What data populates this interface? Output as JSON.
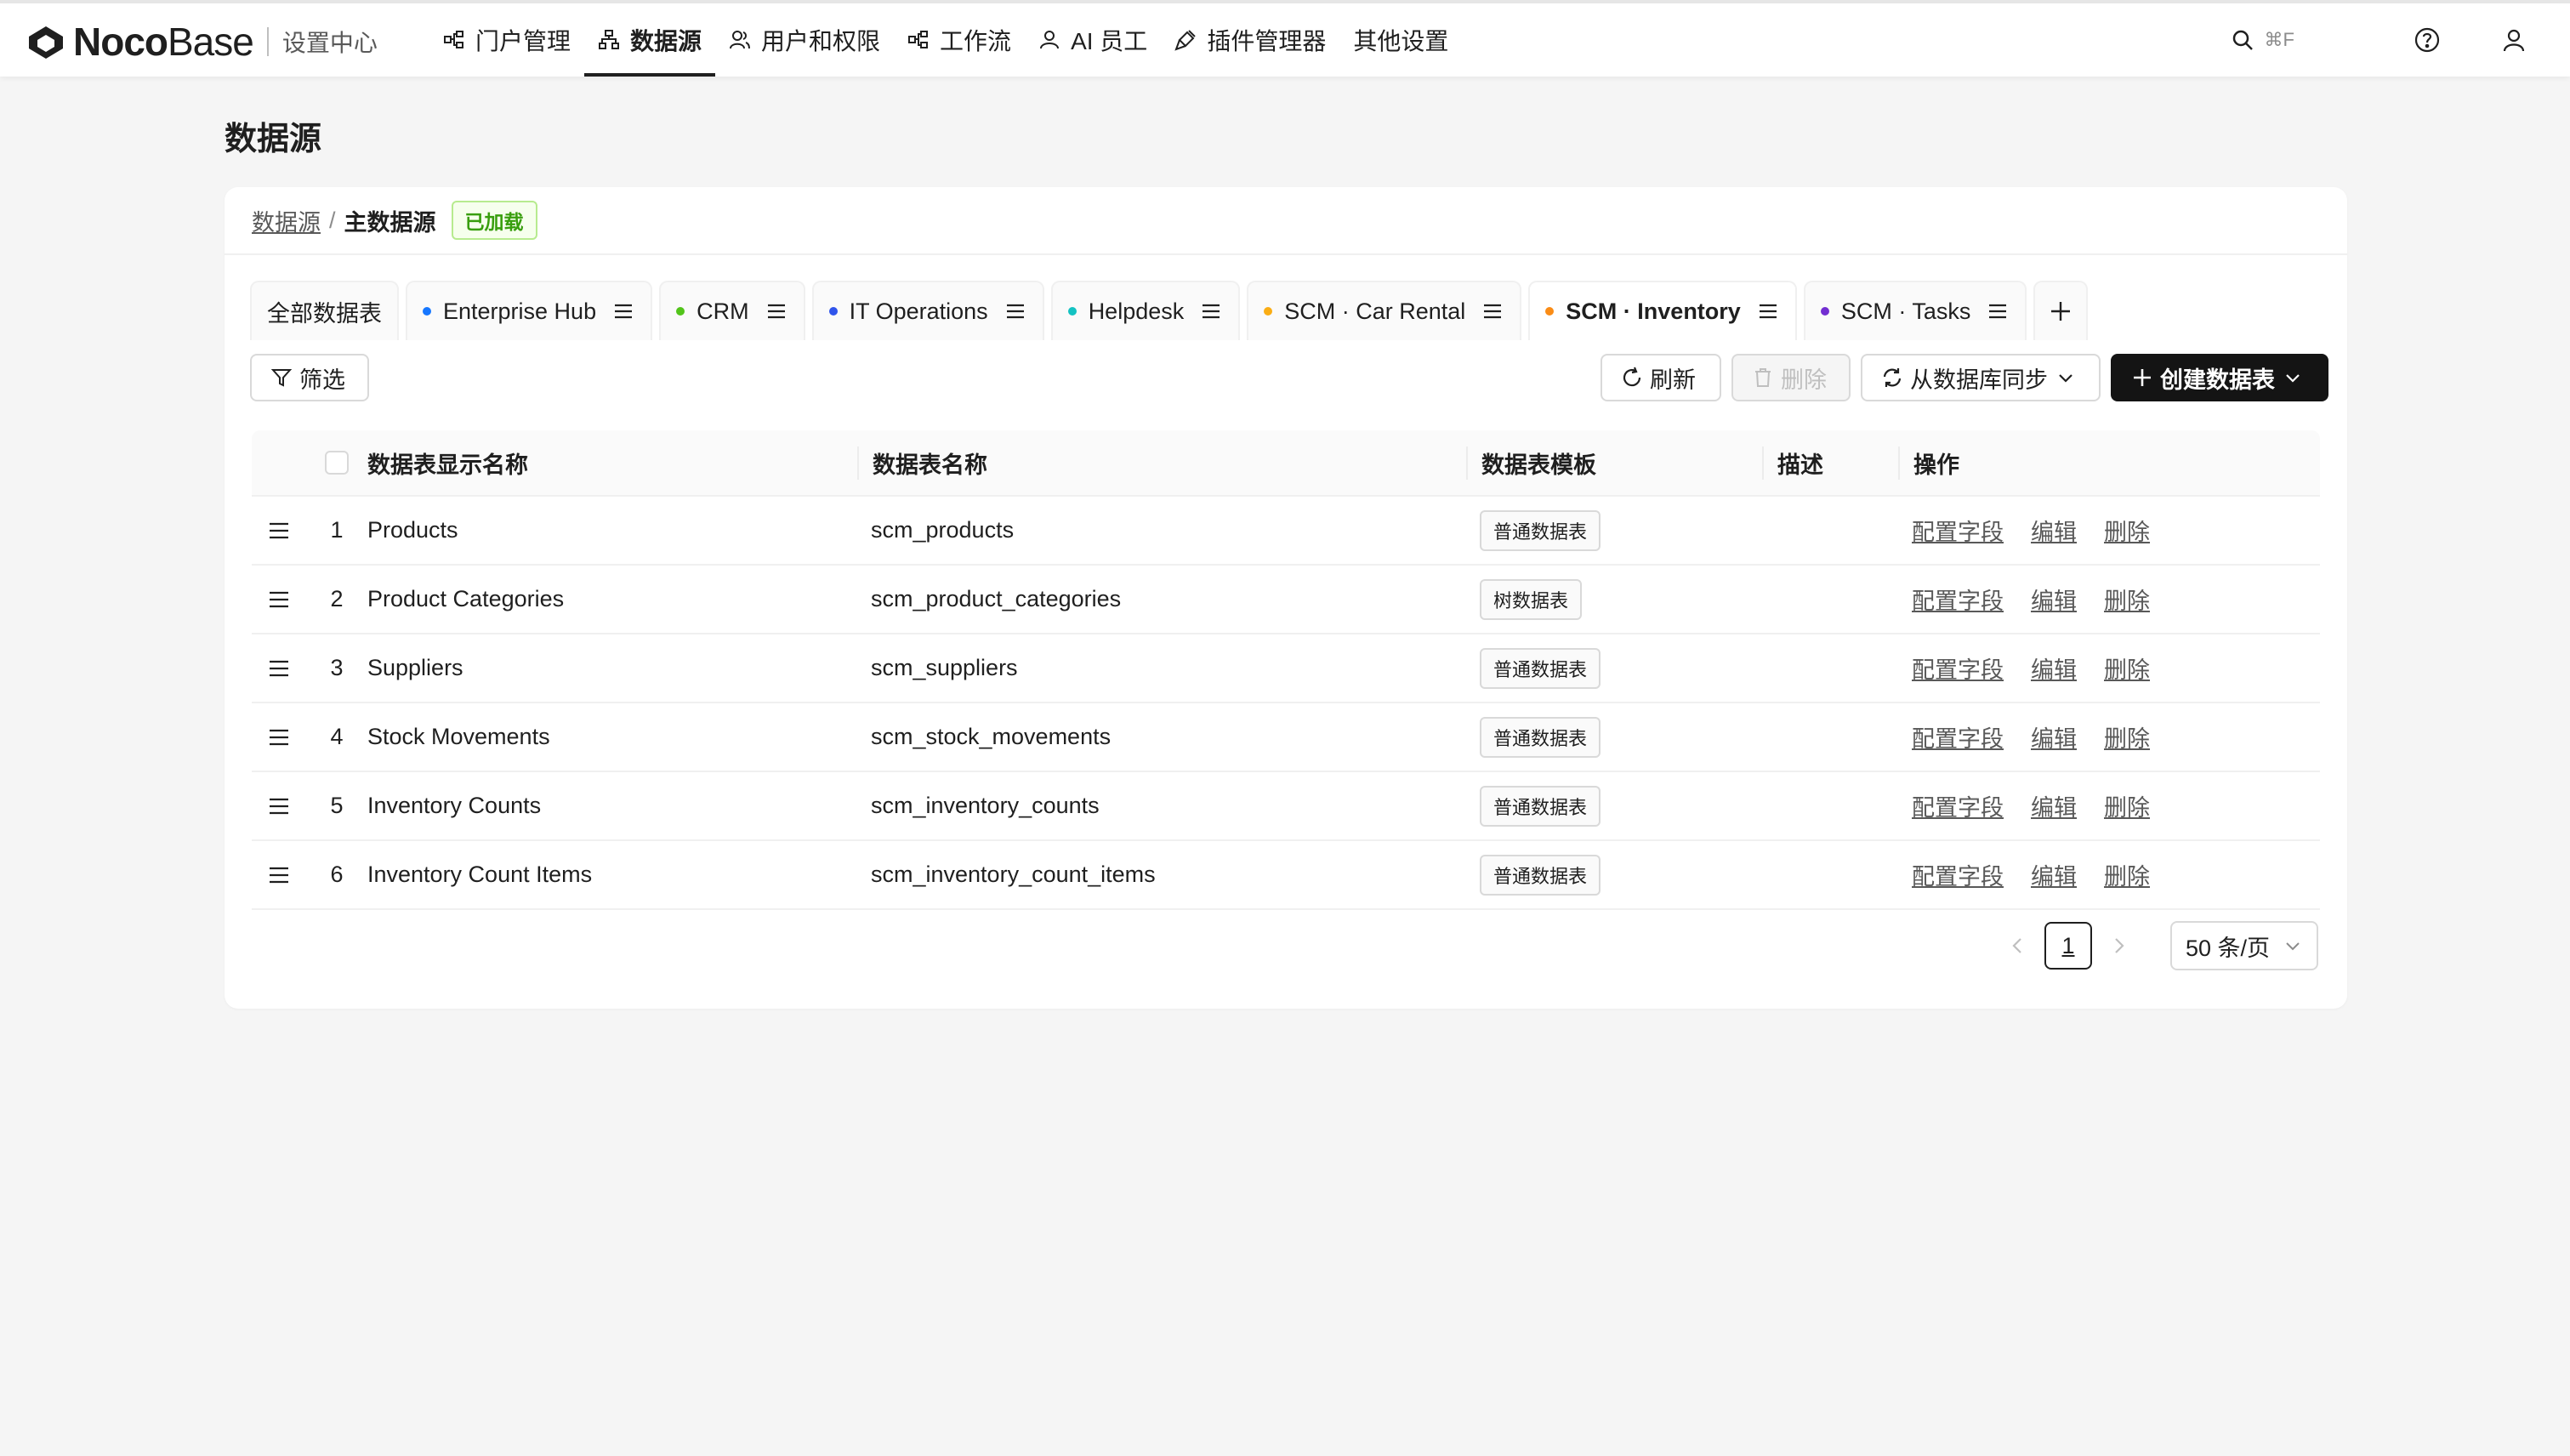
{
  "brand": {
    "name_bold": "Noco",
    "name_light": "Base",
    "subtitle": "设置中心"
  },
  "nav": [
    {
      "label": "门户管理",
      "icon": "portal-icon"
    },
    {
      "label": "数据源",
      "icon": "datasource-icon",
      "active": true
    },
    {
      "label": "用户和权限",
      "icon": "users-icon"
    },
    {
      "label": "工作流",
      "icon": "workflow-icon"
    },
    {
      "label": "AI 员工",
      "icon": "ai-icon"
    },
    {
      "label": "插件管理器",
      "icon": "plugin-icon"
    },
    {
      "label": "其他设置",
      "icon": ""
    }
  ],
  "search": {
    "shortcut": "⌘F"
  },
  "page": {
    "title": "数据源"
  },
  "breadcrumb": {
    "root": "数据源",
    "sep": "/",
    "current": "主数据源",
    "status": "已加载"
  },
  "tabs": [
    {
      "label": "全部数据表",
      "dot": ""
    },
    {
      "label": "Enterprise Hub",
      "dot": "#1677ff"
    },
    {
      "label": "CRM",
      "dot": "#52c41a"
    },
    {
      "label": "IT Operations",
      "dot": "#2f54eb"
    },
    {
      "label": "Helpdesk",
      "dot": "#13c2c2"
    },
    {
      "label": "SCM · Car Rental",
      "dot": "#faad14"
    },
    {
      "label": "SCM · Inventory",
      "dot": "#fa8c16",
      "active": true
    },
    {
      "label": "SCM · Tasks",
      "dot": "#722ed1"
    }
  ],
  "toolbar": {
    "filter": "筛选",
    "refresh": "刷新",
    "delete": "删除",
    "sync": "从数据库同步",
    "create": "创建数据表"
  },
  "table": {
    "headers": {
      "display": "数据表显示名称",
      "name": "数据表名称",
      "template": "数据表模板",
      "desc": "描述",
      "ops": "操作"
    },
    "ops": {
      "configure": "配置字段",
      "edit": "编辑",
      "delete": "删除"
    },
    "rows": [
      {
        "idx": "1",
        "display": "Products",
        "name": "scm_products",
        "template": "普通数据表"
      },
      {
        "idx": "2",
        "display": "Product Categories",
        "name": "scm_product_categories",
        "template": "树数据表"
      },
      {
        "idx": "3",
        "display": "Suppliers",
        "name": "scm_suppliers",
        "template": "普通数据表"
      },
      {
        "idx": "4",
        "display": "Stock Movements",
        "name": "scm_stock_movements",
        "template": "普通数据表"
      },
      {
        "idx": "5",
        "display": "Inventory Counts",
        "name": "scm_inventory_counts",
        "template": "普通数据表"
      },
      {
        "idx": "6",
        "display": "Inventory Count Items",
        "name": "scm_inventory_count_items",
        "template": "普通数据表"
      }
    ]
  },
  "pagination": {
    "page": "1",
    "page_size": "50 条/页"
  }
}
